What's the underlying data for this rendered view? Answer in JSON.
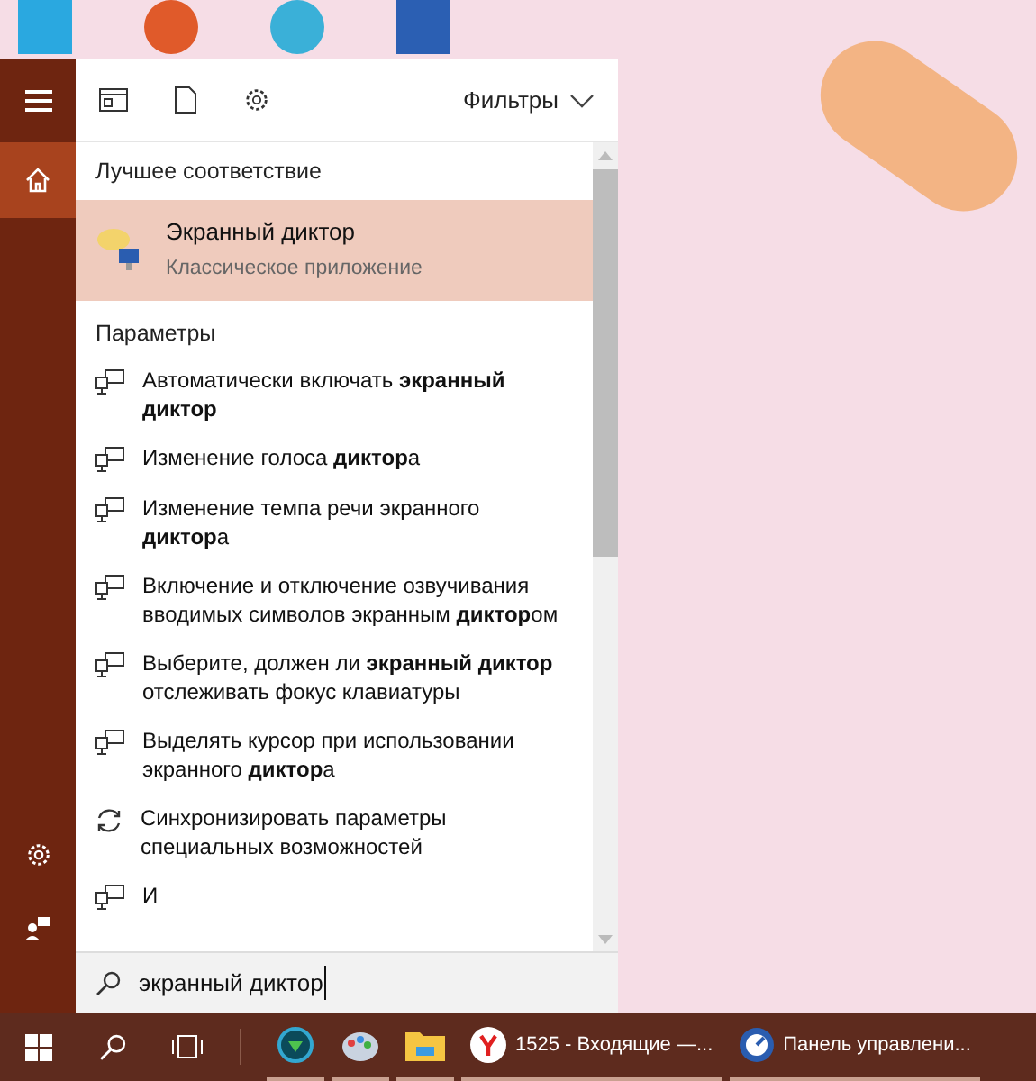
{
  "header": {
    "filters_label": "Фильтры"
  },
  "best_match": {
    "heading": "Лучшее соответствие",
    "title": "Экранный диктор",
    "subtitle": "Классическое приложение",
    "selected": true
  },
  "settings": {
    "heading": "Параметры",
    "items": [
      {
        "kind": "settings",
        "text": "Автоматически включать **экранный диктор**"
      },
      {
        "kind": "settings",
        "text": "Изменение голоса **диктор**а"
      },
      {
        "kind": "settings",
        "text": "Изменение темпа речи экранного **диктор**а"
      },
      {
        "kind": "settings",
        "text": "Включение и отключение озвучивания вводимых символов экранным **диктор**ом"
      },
      {
        "kind": "settings",
        "text": "Выберите, должен ли **экранный диктор** отслеживать фокус клавиатуры"
      },
      {
        "kind": "settings",
        "text": "Выделять курсор при использовании экранного **диктор**а"
      },
      {
        "kind": "sync",
        "text": "Синхронизировать параметры специальных возможностей"
      },
      {
        "kind": "settings",
        "text": "И"
      }
    ]
  },
  "search": {
    "value": "экранный диктор"
  },
  "taskbar": {
    "apps": [
      {
        "kind": "download"
      },
      {
        "kind": "paint"
      },
      {
        "kind": "folder"
      },
      {
        "kind": "browser",
        "label": "1525 - Входящие —..."
      },
      {
        "kind": "control",
        "label": "Панель управлени..."
      }
    ]
  }
}
